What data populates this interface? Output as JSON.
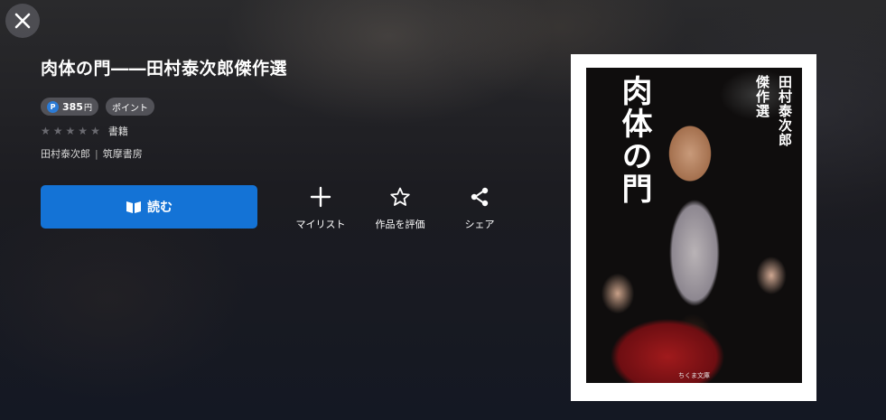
{
  "header": {
    "close_icon": "close-icon"
  },
  "book": {
    "title": "肉体の門――田村泰次郎傑作選",
    "price_badge": {
      "icon": "P",
      "amount": "385",
      "unit": "円"
    },
    "point_badge": "ポイント",
    "rating": {
      "stars_filled": 0,
      "stars_total": 5
    },
    "category": "書籍",
    "author": "田村泰次郎",
    "publisher": "筑摩書房"
  },
  "actions": {
    "read_label": "読む",
    "mylist_label": "マイリスト",
    "rate_label": "作品を評価",
    "share_label": "シェア"
  },
  "cover": {
    "title_lines": [
      "肉体",
      "の門"
    ],
    "subtitle_lines": [
      "田村泰次郎",
      "傑作選"
    ],
    "label": "ちくま文庫"
  },
  "colors": {
    "accent": "#1473d6",
    "point_icon": "#2b7bd6",
    "star_empty": "#6a6a70"
  }
}
